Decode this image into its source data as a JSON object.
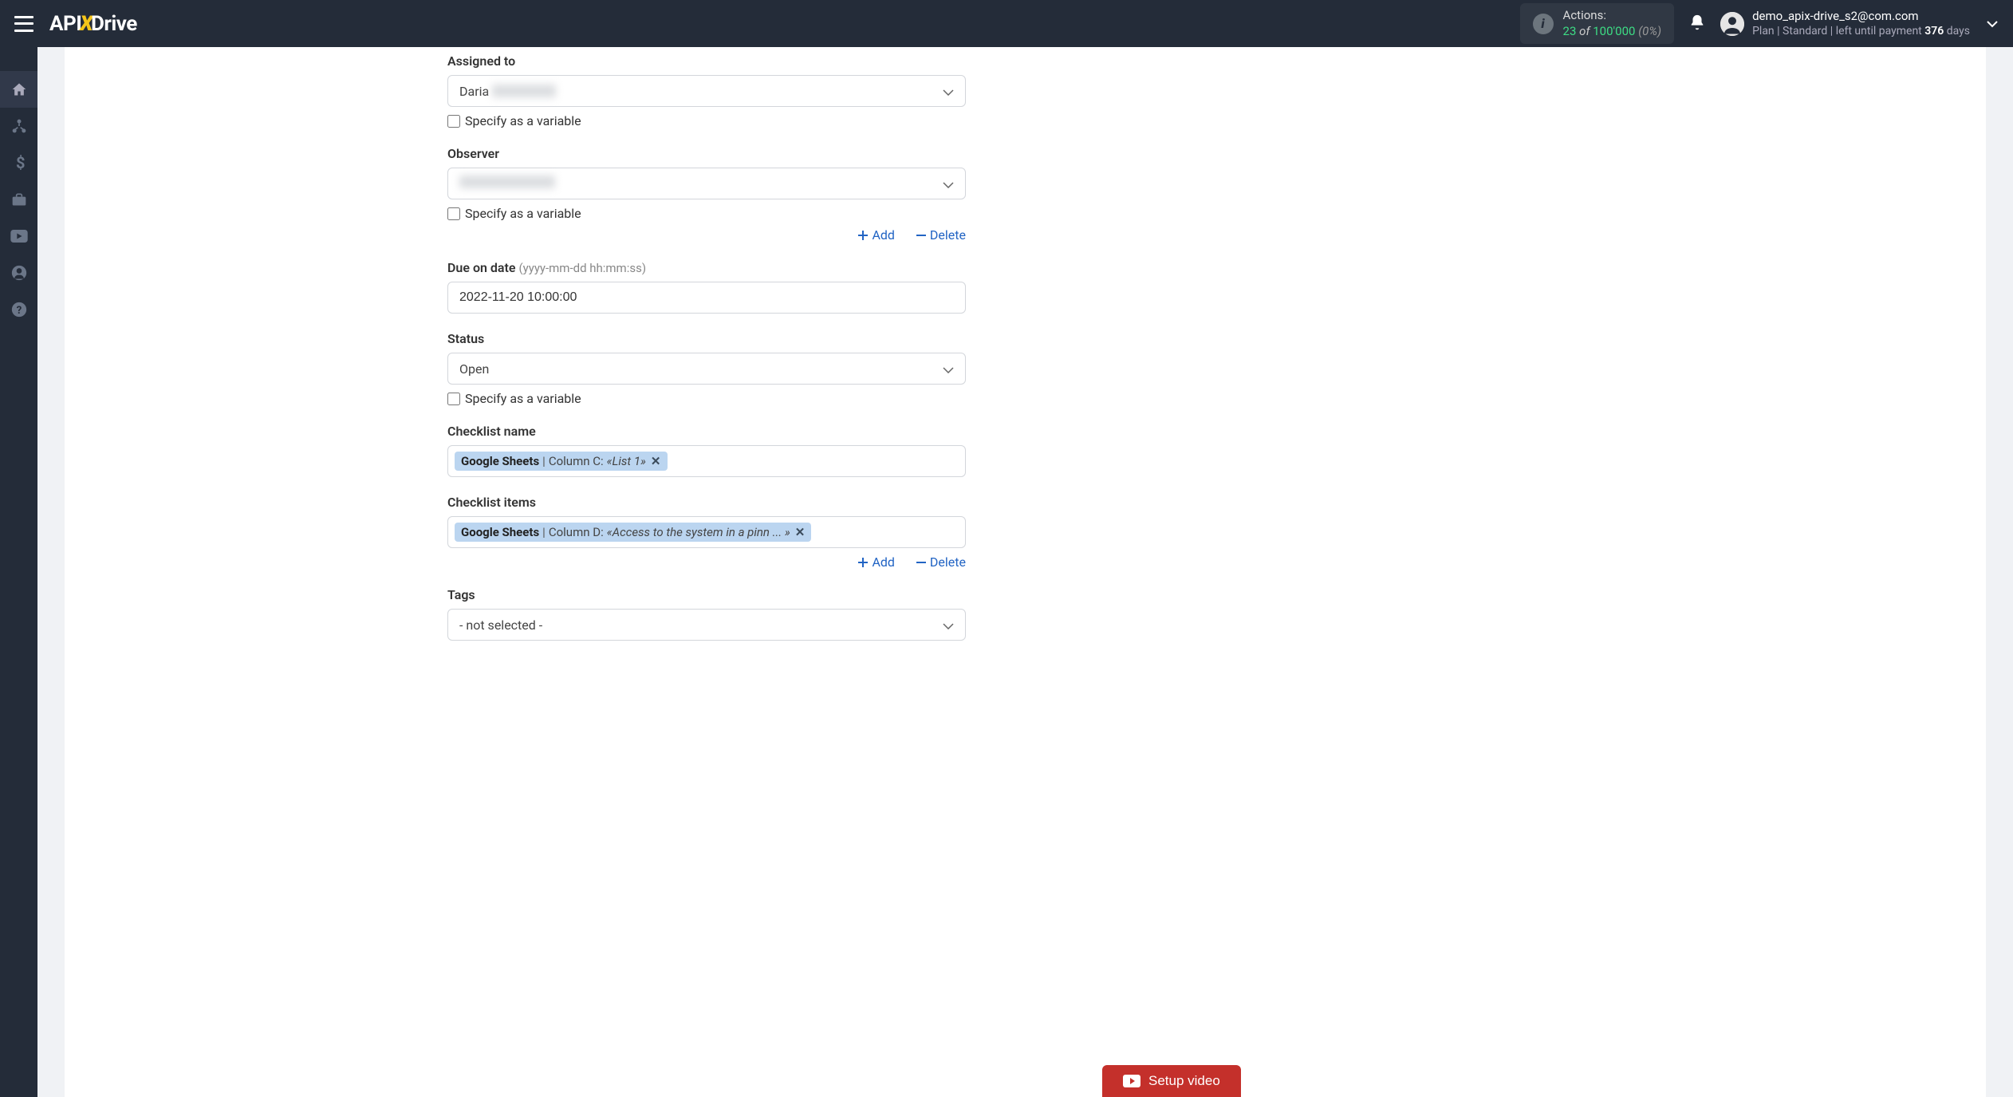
{
  "header": {
    "actions_label": "Actions:",
    "actions_used": "23",
    "actions_of": "of",
    "actions_total": "100'000",
    "actions_pct": "(0%)",
    "user_email": "demo_apix-drive_s2@com.com",
    "plan_prefix": "Plan |",
    "plan_name": "Standard",
    "plan_mid": "| left until payment",
    "plan_days": "376",
    "plan_days_suffix": "days"
  },
  "form": {
    "assigned_to_label": "Assigned to",
    "assigned_to_value": "Daria",
    "specify_variable": "Specify as a variable",
    "observer_label": "Observer",
    "add_link": "Add",
    "delete_link": "Delete",
    "due_label": "Due on date",
    "due_hint": "(yyyy-mm-dd hh:mm:ss)",
    "due_value": "2022-11-20 10:00:00",
    "status_label": "Status",
    "status_value": "Open",
    "checklist_name_label": "Checklist name",
    "checklist_name_tag_source": "Google Sheets",
    "checklist_name_tag_sep": "|",
    "checklist_name_tag_col": "Column C:",
    "checklist_name_tag_val": "«List 1»",
    "checklist_items_label": "Checklist items",
    "checklist_items_tag_source": "Google Sheets",
    "checklist_items_tag_sep": "|",
    "checklist_items_tag_col": "Column D:",
    "checklist_items_tag_val": "«Access to the system in a pinn ... »",
    "tags_label": "Tags",
    "tags_value": "- not selected -",
    "setup_video": "Setup video"
  }
}
